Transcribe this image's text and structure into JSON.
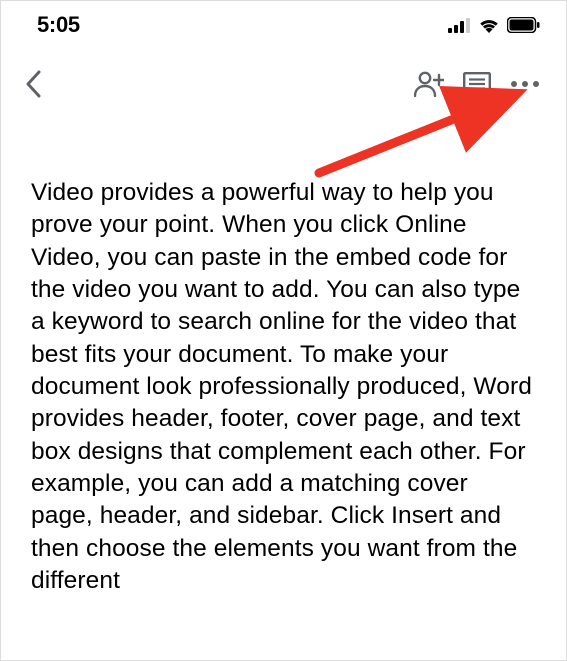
{
  "status": {
    "time": "5:05"
  },
  "document": {
    "body": "Video provides a powerful way to help you prove your point. When you click Online Video, you can paste in the embed code for the video you want to add. You can also type a keyword to search online for the video that best fits your document. To make your document look professionally produced, Word provides header, footer, cover page, and text box designs that complement each other. For example, you can add a matching cover page, header, and sidebar. Click Insert and then choose the elements you want from the different"
  },
  "annotation": {
    "arrow_color": "#ED3323"
  }
}
